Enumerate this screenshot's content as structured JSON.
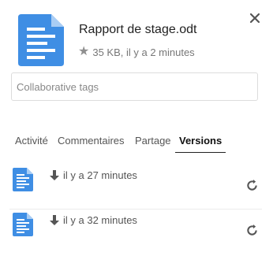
{
  "file": {
    "name": "Rapport de stage.odt",
    "meta": "35 KB, il y a 2 minutes",
    "icon": "document-icon",
    "icon_color": "#3f8ee4"
  },
  "tags": {
    "placeholder": "Collaborative tags",
    "value": ""
  },
  "tabs": [
    {
      "label": "Activité"
    },
    {
      "label": "Commentaires"
    },
    {
      "label": "Partage"
    },
    {
      "label": "Versions",
      "active": true
    }
  ],
  "versions": [
    {
      "time": "il y a 27 minutes"
    },
    {
      "time": "il y a 32 minutes"
    }
  ],
  "icons": {
    "favorite": "star-icon",
    "close": "close-icon",
    "download": "download-icon",
    "restore": "restore-icon"
  }
}
